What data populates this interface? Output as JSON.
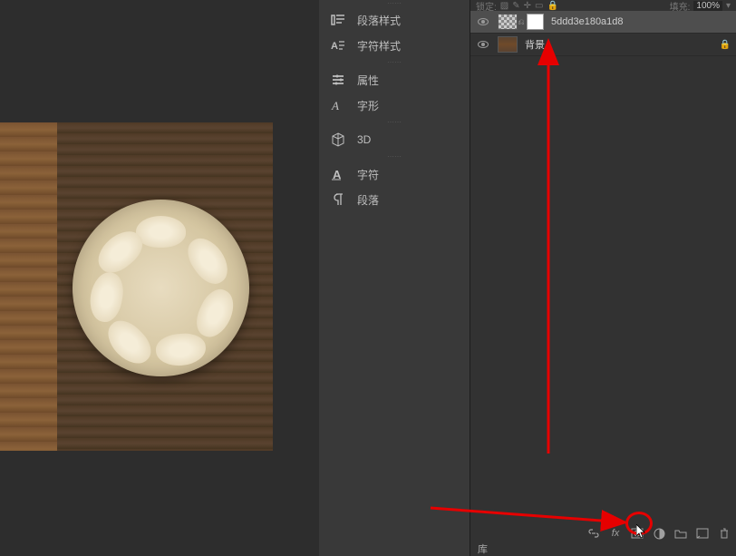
{
  "lockbar": {
    "label": "锁定:",
    "fill_label": "填充:",
    "fill_value": "100%"
  },
  "panels": {
    "paragraph_styles": "段落样式",
    "char_styles": "字符样式",
    "properties": "属性",
    "glyphs": "字形",
    "threed": "3D",
    "character": "字符",
    "paragraph": "段落"
  },
  "layers": {
    "items": [
      {
        "name": "5ddd3e180a1d8",
        "has_mask": true,
        "locked": false
      },
      {
        "name": "背景",
        "has_mask": false,
        "locked": true
      }
    ]
  },
  "footer": {
    "tab_label": "库"
  }
}
